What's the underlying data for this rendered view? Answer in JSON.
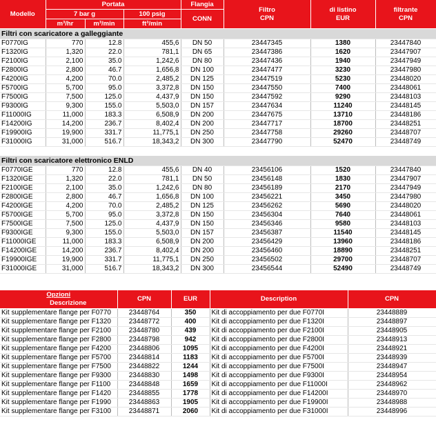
{
  "header": {
    "modello": "Modello",
    "portata": "Portata",
    "bar": "7 bar g",
    "psig": "100 psig",
    "m3hr": "m³/hr",
    "m3min": "m³/min",
    "ft3min": "ft³/min",
    "flangia": "Flangia",
    "conn": "CONN",
    "filtro": "Filtro",
    "filtro_cpn": "CPN",
    "listino": "di listino",
    "eur": "EUR",
    "filtrante": "filtrante",
    "filtrante_cpn": "CPN"
  },
  "section1": {
    "title": "Filtri con scaricatore a galleggiante",
    "rows": [
      [
        "F0770IG",
        "770",
        "12.8",
        "455,6",
        "DN 50",
        "23447345",
        "1380",
        "23447840"
      ],
      [
        "F1320IG",
        "1,320",
        "22.0",
        "781,1",
        "DN 65",
        "23447386",
        "1620",
        "23447907"
      ],
      [
        "F2100IG",
        "2,100",
        "35.0",
        "1,242,6",
        "DN 80",
        "23447436",
        "1940",
        "23447949"
      ],
      [
        "F2800IG",
        "2,800",
        "46.7",
        "1,656,8",
        "DN 100",
        "23447477",
        "3230",
        "23447980"
      ],
      [
        "F4200IG",
        "4,200",
        "70.0",
        "2,485,2",
        "DN 125",
        "23447519",
        "5230",
        "23448020"
      ],
      [
        "F5700IG",
        "5,700",
        "95.0",
        "3,372,8",
        "DN 150",
        "23447550",
        "7400",
        "23448061"
      ],
      [
        "F7500IG",
        "7,500",
        "125.0",
        "4,437,9",
        "DN 150",
        "23447592",
        "9290",
        "23448103"
      ],
      [
        "F9300IG",
        "9,300",
        "155.0",
        "5,503,0",
        "DN 157",
        "23447634",
        "11240",
        "23448145"
      ],
      [
        "F11000IG",
        "11,000",
        "183.3",
        "6,508,9",
        "DN 200",
        "23447675",
        "13710",
        "23448186"
      ],
      [
        "F14200IG",
        "14,200",
        "236.7",
        "8,402,4",
        "DN 200",
        "23447717",
        "18700",
        "23448251"
      ],
      [
        "F19900IG",
        "19,900",
        "331.7",
        "11,775,1",
        "DN 250",
        "23447758",
        "29260",
        "23448707"
      ],
      [
        "F31000IG",
        "31,000",
        "516.7",
        "18,343,2",
        "DN 300",
        "23447790",
        "52470",
        "23448749"
      ]
    ]
  },
  "section2": {
    "title": "Filtri con scaricatore elettronico ENLD",
    "rows": [
      [
        "F0770IGE",
        "770",
        "12.8",
        "455,6",
        "DN 40",
        "23456106",
        "1520",
        "23447840"
      ],
      [
        "F1320IGE",
        "1,320",
        "22.0",
        "781,1",
        "DN 50",
        "23456148",
        "1830",
        "23447907"
      ],
      [
        "F2100IGE",
        "2,100",
        "35.0",
        "1,242,6",
        "DN 80",
        "23456189",
        "2170",
        "23447949"
      ],
      [
        "F2800IGE",
        "2,800",
        "46.7",
        "1,656,8",
        "DN 100",
        "23456221",
        "3450",
        "23447980"
      ],
      [
        "F4200IGE",
        "4,200",
        "70.0",
        "2,485,2",
        "DN 125",
        "23456262",
        "5690",
        "23448020"
      ],
      [
        "F5700IGE",
        "5,700",
        "95.0",
        "3,372,8",
        "DN 150",
        "23456304",
        "7640",
        "23448061"
      ],
      [
        "F7500IGE",
        "7,500",
        "125.0",
        "4,437,9",
        "DN 150",
        "23456346",
        "9580",
        "23448103"
      ],
      [
        "F9300IGE",
        "9,300",
        "155.0",
        "5,503,0",
        "DN 157",
        "23456387",
        "11540",
        "23448145"
      ],
      [
        "F11000IGE",
        "11,000",
        "183.3",
        "6,508,9",
        "DN 200",
        "23456429",
        "13960",
        "23448186"
      ],
      [
        "F14200IGE",
        "14,200",
        "236.7",
        "8,402,4",
        "DN 200",
        "23456460",
        "18890",
        "23448251"
      ],
      [
        "F19900IGE",
        "19,900",
        "331.7",
        "11,775,1",
        "DN 250",
        "23456502",
        "29700",
        "23448707"
      ],
      [
        "F31000IGE",
        "31,000",
        "516.7",
        "18,343,2",
        "DN 300",
        "23456544",
        "52490",
        "23448749"
      ]
    ]
  },
  "options": {
    "opzioni": "Opzioni",
    "descrizione": "Descrizione",
    "cpn": "CPN",
    "eur": "EUR",
    "description": "Description",
    "cpn2": "CPN",
    "rows": [
      [
        "Kit supplementare flange per F0770",
        "23448764",
        "350",
        "Kit di accoppiamento per due F0770I",
        "23448889"
      ],
      [
        "Kit supplementare flange per F1320",
        "23448772",
        "400",
        "Kit di accoppiamento per due F1320I",
        "23448897"
      ],
      [
        "Kit supplementare flange per F2100",
        "23448780",
        "439",
        "Kit di accoppiamento per due F2100I",
        "23448905"
      ],
      [
        "Kit supplementare flange per F2800",
        "23448798",
        "942",
        "Kit di accoppiamento per due F2800I",
        "23448913"
      ],
      [
        "Kit supplementare flange per F4200",
        "23448806",
        "1095",
        "Kit di accoppiamento per due F4200I",
        "23448921"
      ],
      [
        "Kit supplementare flange per F5700",
        "23448814",
        "1183",
        "Kit di accoppiamento per due F5700I",
        "23448939"
      ],
      [
        "Kit supplementare flange per F7500",
        "23448822",
        "1244",
        "Kit di accoppiamento per due F7500I",
        "23448947"
      ],
      [
        "Kit supplementare flange per F9300",
        "23448830",
        "1498",
        "Kit di accoppiamento per due F9300I",
        "23448954"
      ],
      [
        "Kit supplementare flange per F1100",
        "23448848",
        "1659",
        "Kit di accoppiamento per due F11000I",
        "23448962"
      ],
      [
        "Kit supplementare flange per F1420",
        "23448855",
        "1778",
        "Kit di accoppiamento per due F14200I",
        "23448970"
      ],
      [
        "Kit supplementare flange per F1990",
        "23448863",
        "1905",
        "Kit di accoppiamento per due F19900I",
        "23448988"
      ],
      [
        "Kit supplementare flange per F3100",
        "23448871",
        "2060",
        "Kit di accoppiamento per due F31000I",
        "23448996"
      ]
    ]
  }
}
